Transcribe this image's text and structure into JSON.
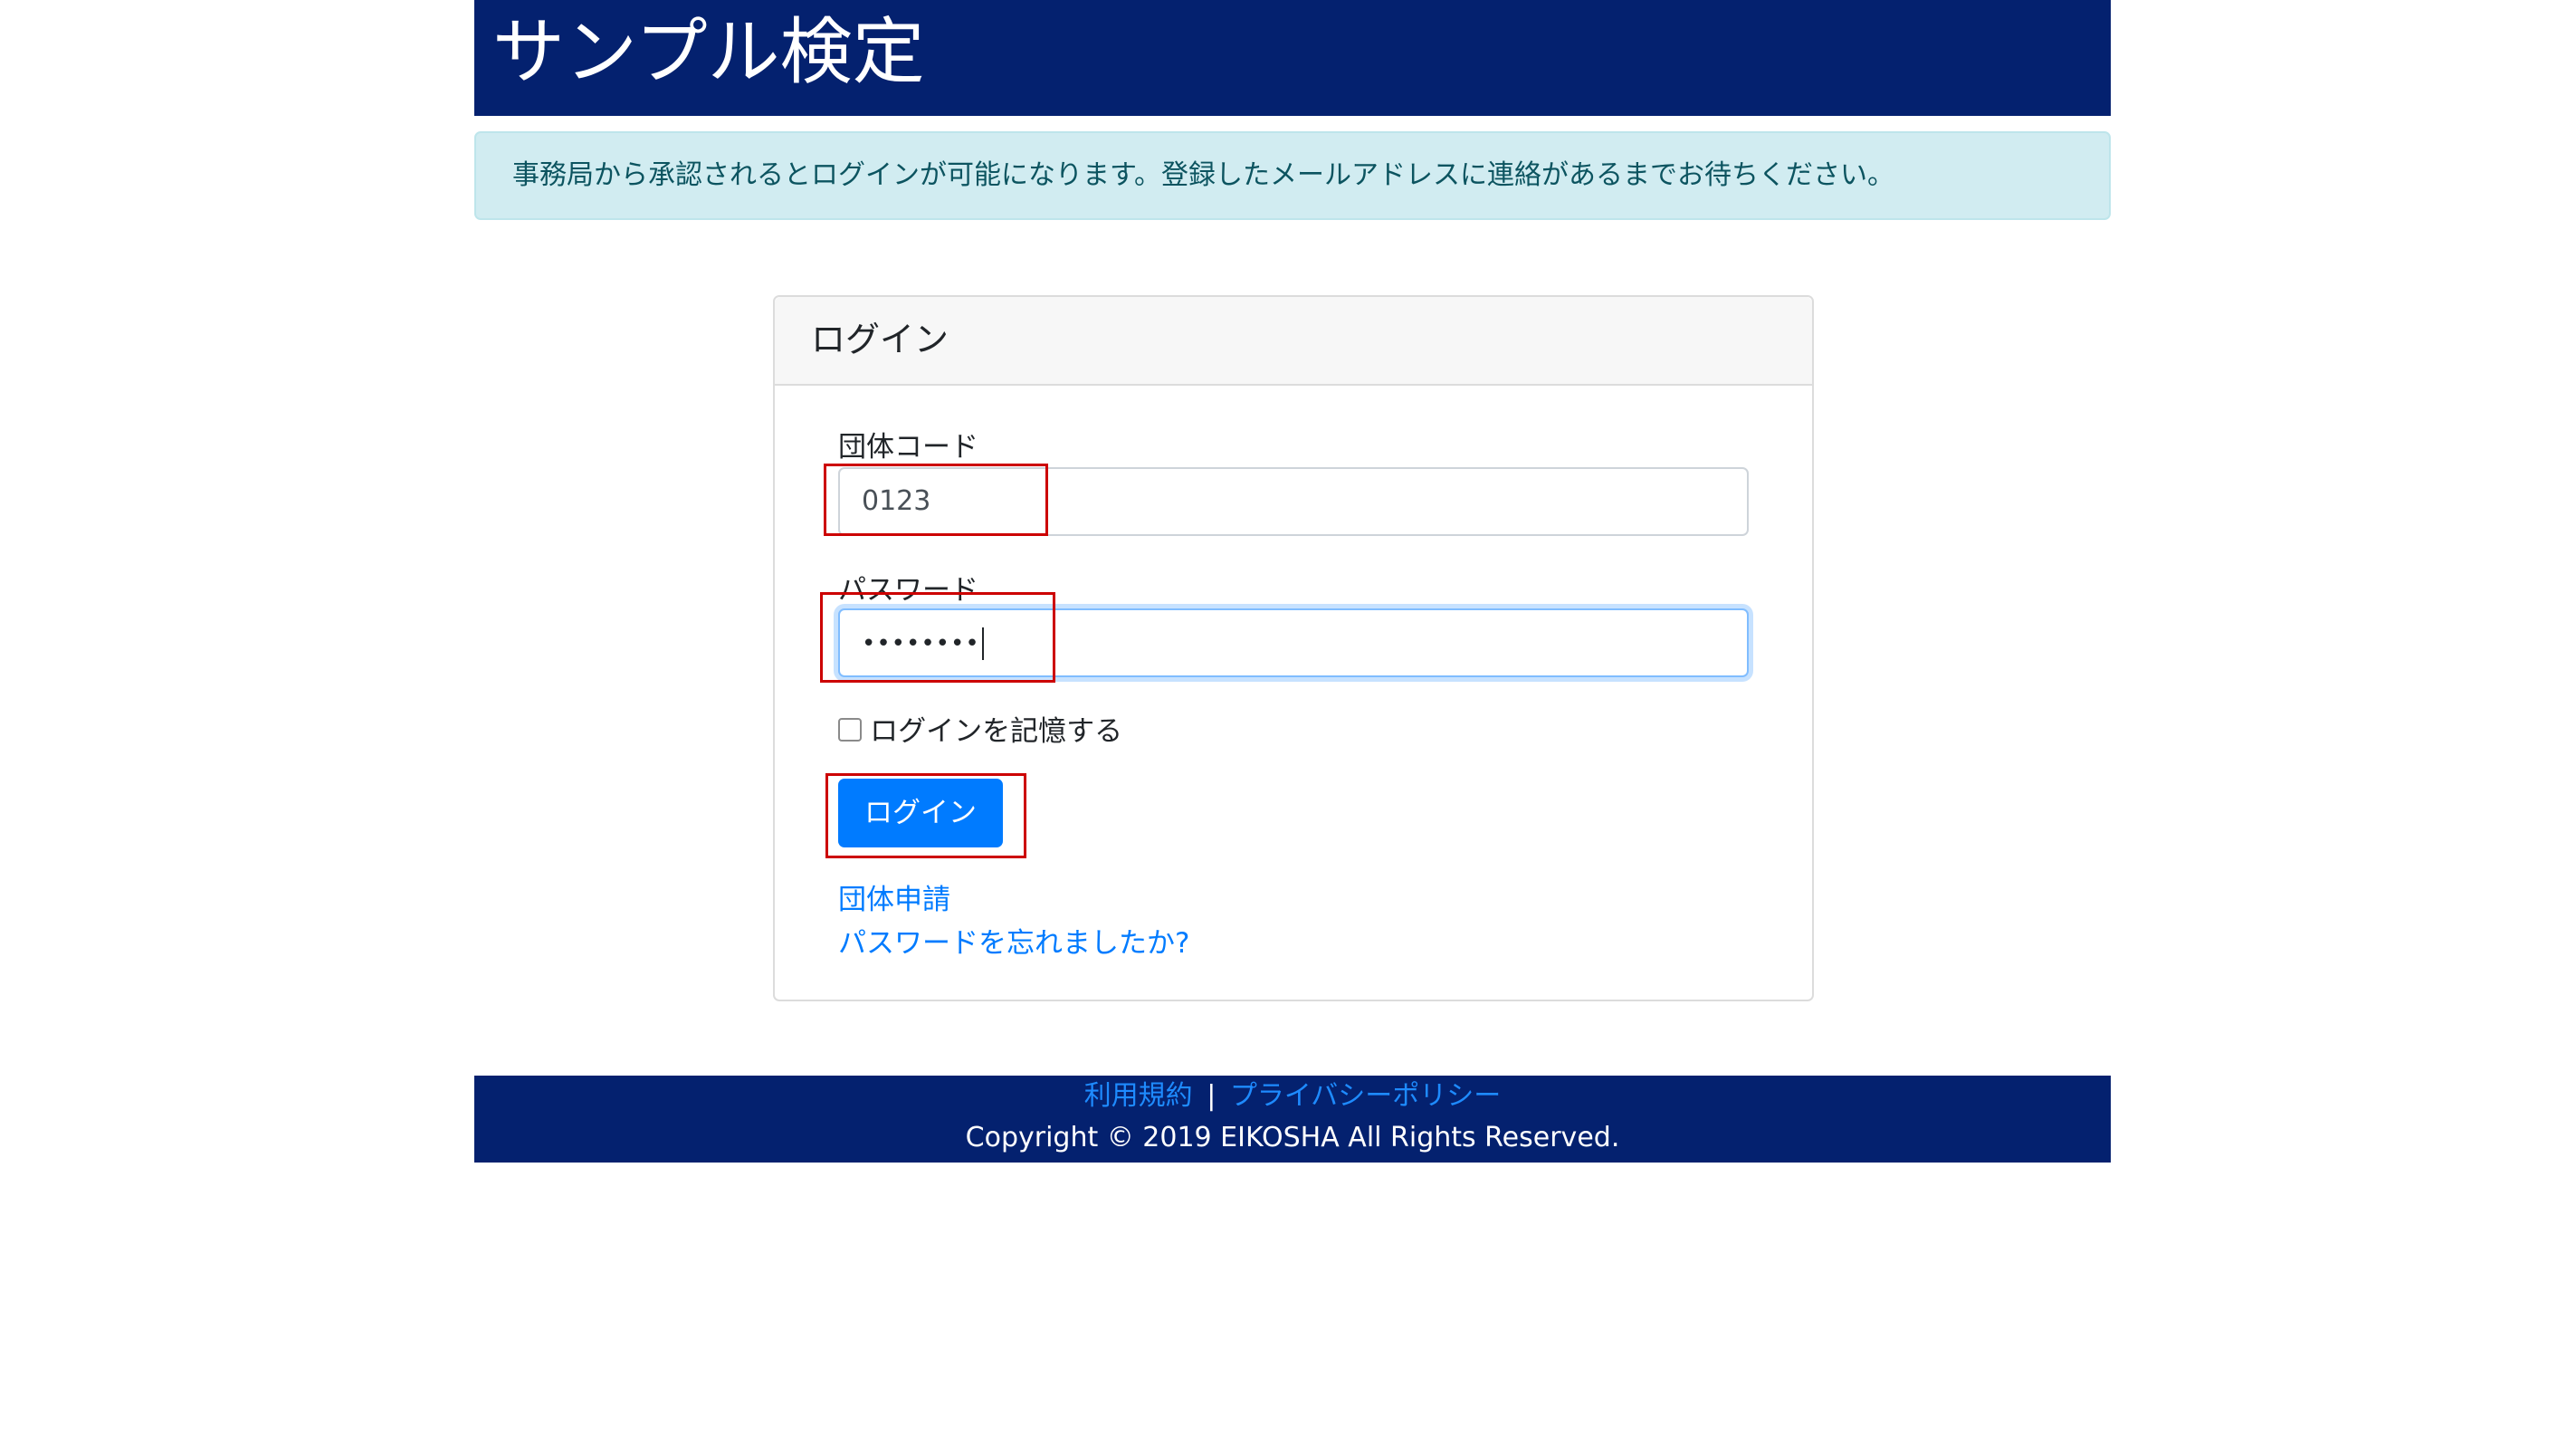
{
  "header": {
    "title": "サンプル検定"
  },
  "alert": {
    "message": "事務局から承認されるとログインが可能になります。登録したメールアドレスに連絡があるまでお待ちください。"
  },
  "login_card": {
    "title": "ログイン",
    "group_code": {
      "label": "団体コード",
      "value": "0123"
    },
    "password": {
      "label": "パスワード",
      "masked_value": "••••••••"
    },
    "remember": {
      "label": "ログインを記憶する",
      "checked": false
    },
    "submit_label": "ログイン",
    "links": {
      "register": "団体申請",
      "forgot_password": "パスワードを忘れましたか?"
    }
  },
  "footer": {
    "terms": "利用規約",
    "separator": "|",
    "privacy": "プライバシーポリシー",
    "copyright": "Copyright © 2019 EIKOSHA All Rights Reserved."
  },
  "colors": {
    "header_bg": "#04216f",
    "alert_bg": "#d1ecf1",
    "primary": "#007bff",
    "annotation": "#cc0000"
  }
}
